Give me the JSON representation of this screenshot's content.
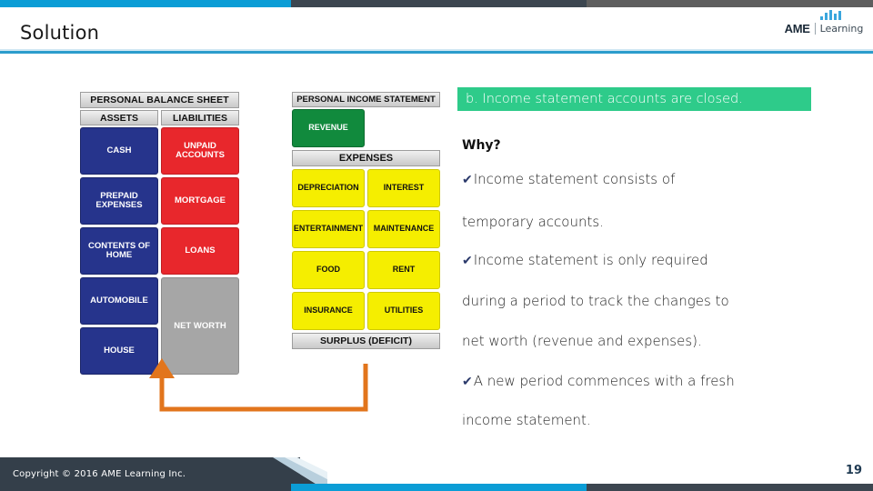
{
  "header": {
    "title": "Solution",
    "logo": {
      "brand": "AME",
      "sub": "Learning",
      "bars": [
        4,
        8,
        11,
        7,
        10
      ]
    }
  },
  "theme": {
    "top_bar_blue": "#0b9dd6",
    "top_bar_dark": "#3c4650",
    "top_bar_gray": "#5e5e5e",
    "rule_blue": "#2b9ccc",
    "banner_green": "#2ecb8a",
    "arrow_orange": "#e2751c",
    "footer_navy": "#343f4a",
    "page_num_color": "#1f3a52",
    "asset_blue": "#26348c",
    "liability_red": "#e8272c",
    "networth_gray": "#a6a6a6",
    "revenue_green": "#118a3d",
    "expense_yellow": "#f5ee00"
  },
  "balance_sheet": {
    "title": "PERSONAL BALANCE SHEET",
    "col_headers": [
      "ASSETS",
      "LIABILITIES"
    ],
    "assets": [
      {
        "label": "CASH",
        "height": 52
      },
      {
        "label": "PREPAID EXPENSES",
        "height": 52
      },
      {
        "label": "CONTENTS OF HOME",
        "height": 52
      },
      {
        "label": "AUTOMOBILE",
        "height": 52
      },
      {
        "label": "HOUSE",
        "height": 52
      }
    ],
    "liabilities": [
      {
        "label": "UNPAID ACCOUNTS",
        "height": 52
      },
      {
        "label": "MORTGAGE",
        "height": 52
      },
      {
        "label": "LOANS",
        "height": 52
      },
      {
        "label": "NET WORTH",
        "height": 107
      }
    ]
  },
  "income_statement": {
    "title": "PERSONAL INCOME STATEMENT",
    "revenue": "REVENUE",
    "expenses_header": "EXPENSES",
    "expenses": [
      [
        "DEPRECIATION",
        "INTEREST"
      ],
      [
        "ENTERTAINMENT",
        "MAINTENANCE"
      ],
      [
        "FOOD",
        "RENT"
      ],
      [
        "INSURANCE",
        "UTILITIES"
      ]
    ],
    "surplus": "SURPLUS (DEFICIT)"
  },
  "content": {
    "banner": "b. Income statement accounts are closed.",
    "why": "Why?",
    "lines": [
      {
        "tick": true,
        "text": "Income statement consists of"
      },
      {
        "tick": false,
        "text": "temporary accounts."
      },
      {
        "tick": true,
        "text": "Income statement is only required"
      },
      {
        "tick": false,
        "text": "during a period to track the changes to"
      },
      {
        "tick": false,
        "text": "net worth (revenue and expenses)."
      },
      {
        "tick": true,
        "text": "A new period commences with a fresh"
      },
      {
        "tick": false,
        "text": "income statement."
      }
    ]
  },
  "footer": {
    "copyright": "Copyright © 2016 AME Learning Inc.",
    "page_number": "19"
  }
}
